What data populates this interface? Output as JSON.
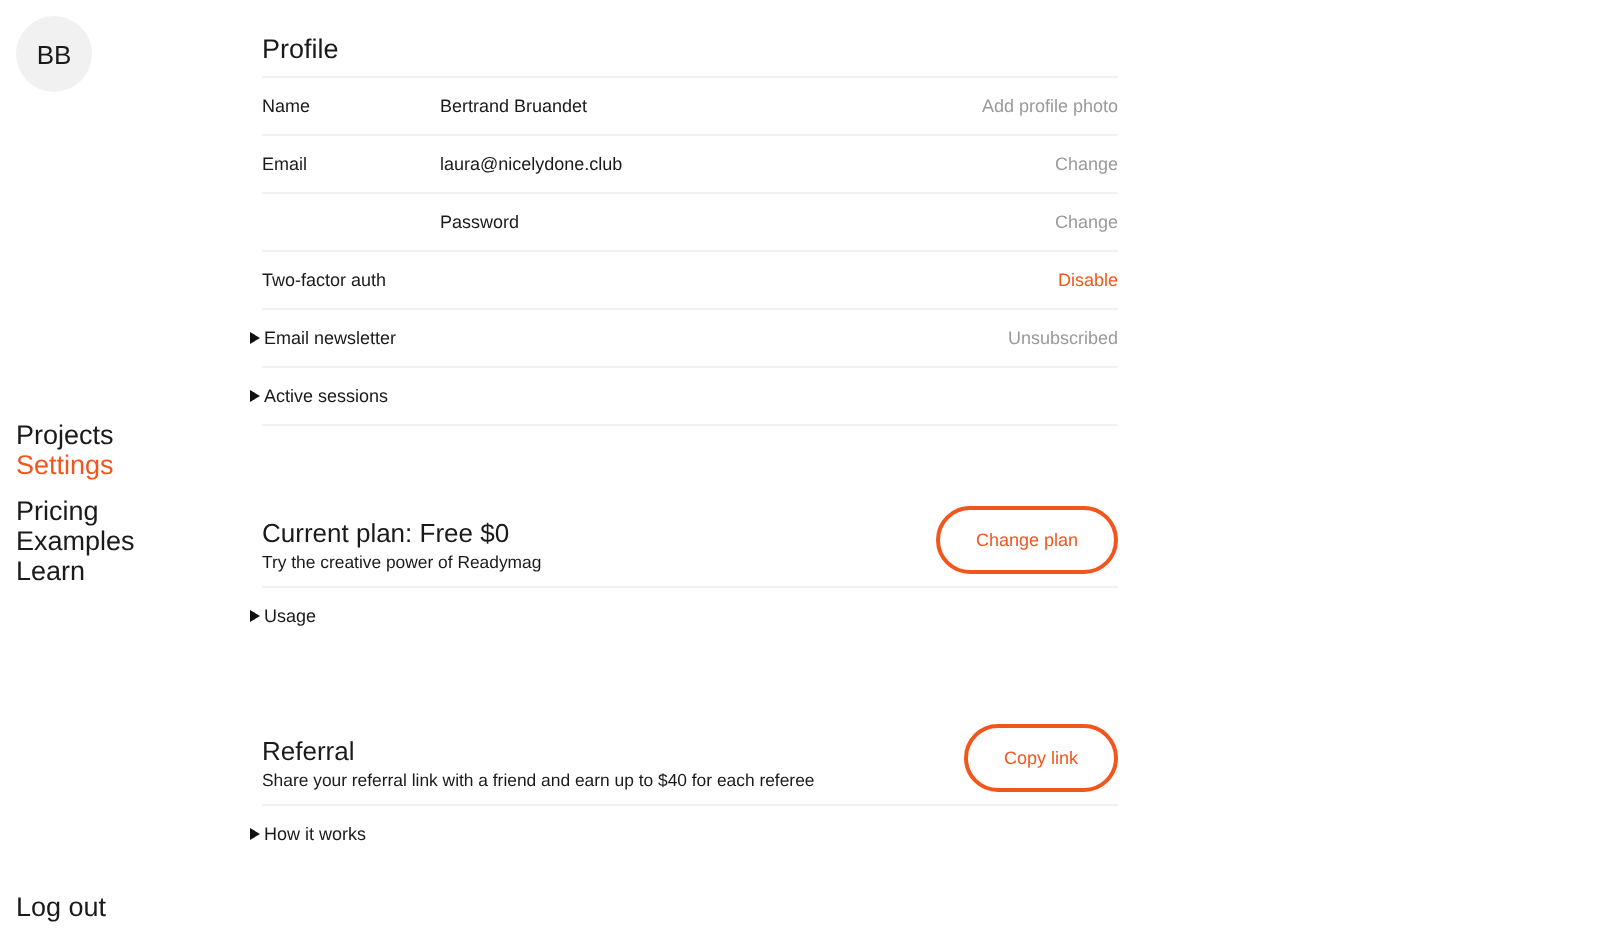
{
  "sidebar": {
    "avatar": {
      "initials": "BB"
    },
    "nav_groups": [
      [
        {
          "label": "Projects",
          "selected": false
        },
        {
          "label": "Settings",
          "selected": true
        }
      ],
      [
        {
          "label": "Pricing",
          "selected": false
        },
        {
          "label": "Examples",
          "selected": false
        },
        {
          "label": "Learn",
          "selected": false
        }
      ]
    ],
    "logout": "Log out"
  },
  "profile": {
    "title": "Profile",
    "rows": [
      {
        "kind": "field",
        "label": "Name",
        "value": "Bertrand Bruandet",
        "action": "Add profile photo",
        "color": "#9a9a9a"
      },
      {
        "kind": "field",
        "label": "Email",
        "value": "laura@nicelydone.club",
        "action": "Change",
        "color": "#9a9a9a"
      },
      {
        "kind": "field",
        "value": "Password",
        "action": "Change",
        "color": "#9a9a9a"
      },
      {
        "kind": "field",
        "label": "Two-factor auth",
        "action": "Disable",
        "color": "#f2561d"
      },
      {
        "kind": "expander",
        "label": "Email newsletter",
        "expanded": false,
        "action": "Unsubscribed",
        "color": "#9a9a9a"
      },
      {
        "kind": "expander",
        "label": "Active sessions",
        "expanded": false
      }
    ]
  },
  "sections": [
    {
      "title": "Current plan: Free $0",
      "subtitle": "Try the creative power of Readymag",
      "button": "Change plan",
      "details": [
        {
          "label": "Usage",
          "expanded": false
        }
      ]
    },
    {
      "title": "Referral",
      "subtitle": "Share your referral link with a friend and earn up to $40 for each referee",
      "button": "Copy link",
      "details": [
        {
          "label": "How it works",
          "expanded": false
        }
      ]
    }
  ]
}
